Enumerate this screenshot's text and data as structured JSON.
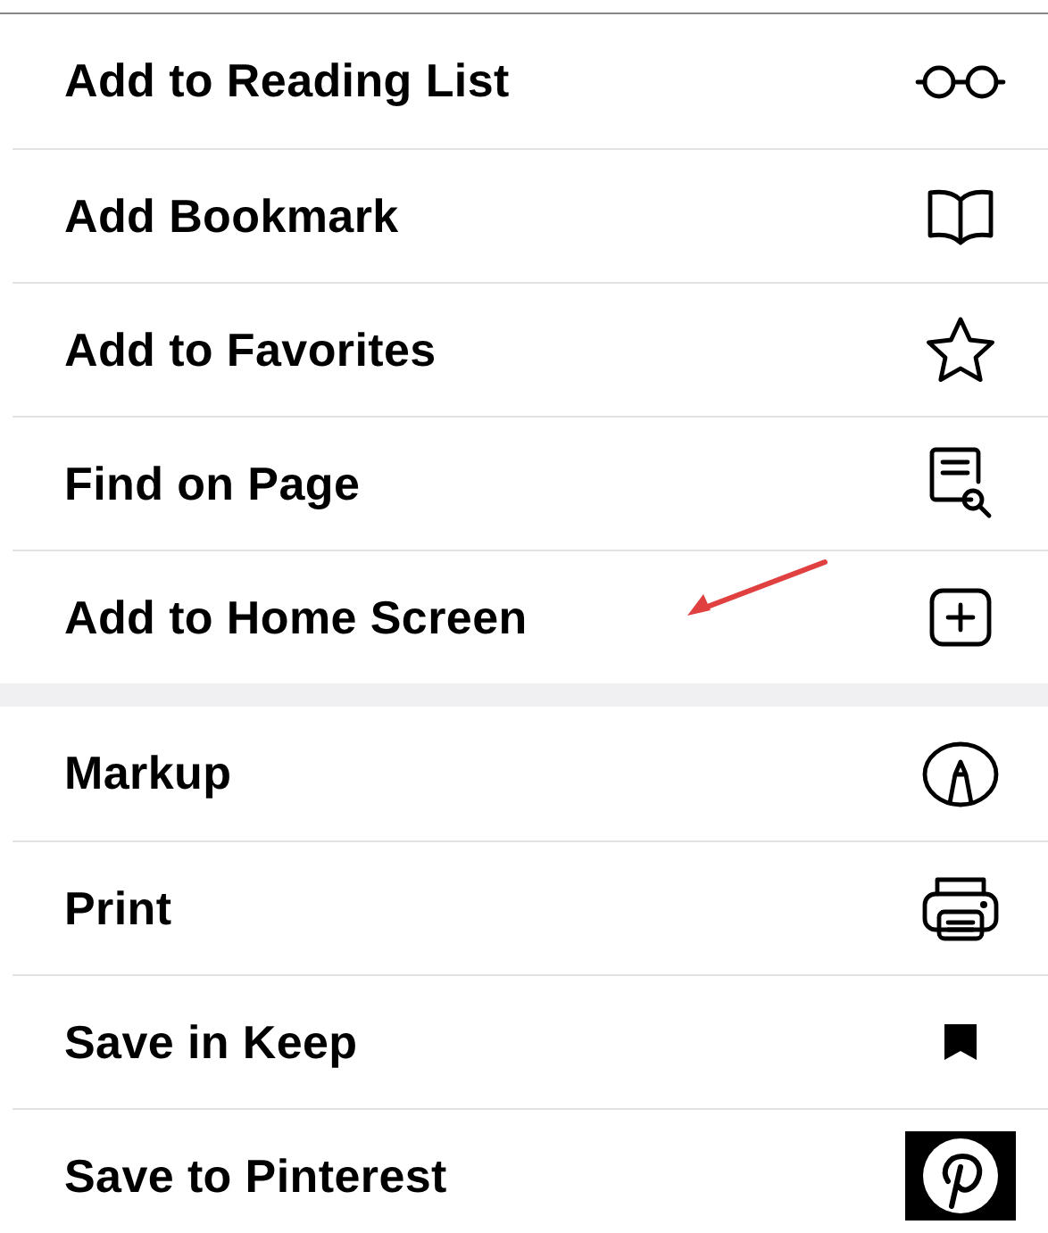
{
  "groups": [
    {
      "items": [
        {
          "label": "Add to Reading List"
        },
        {
          "label": "Add Bookmark"
        },
        {
          "label": "Add to Favorites"
        },
        {
          "label": "Find on Page"
        },
        {
          "label": "Add to Home Screen"
        }
      ]
    },
    {
      "items": [
        {
          "label": "Markup"
        },
        {
          "label": "Print"
        },
        {
          "label": "Save in Keep"
        },
        {
          "label": "Save to Pinterest"
        }
      ]
    }
  ]
}
